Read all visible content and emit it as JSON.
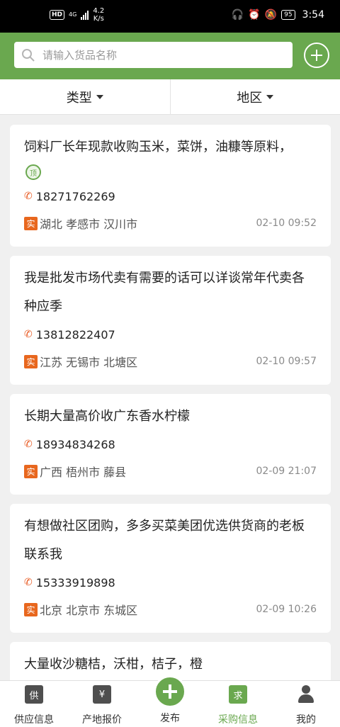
{
  "status_bar": {
    "hd": "HD",
    "network": "4G",
    "speed_value": "4.2",
    "speed_unit": "K/s",
    "battery": "95",
    "time": "3:54"
  },
  "search": {
    "placeholder": "请输入货品名称"
  },
  "filters": [
    {
      "label": "类型"
    },
    {
      "label": "地区"
    }
  ],
  "listings": [
    {
      "title": "饲料厂长年现款收购玉米，菜饼，油糠等原料，",
      "badge": "顶",
      "phone": "18271762269",
      "tag": "实",
      "location": "湖北 孝感市 汉川市",
      "time": "02-10 09:52"
    },
    {
      "title": "我是批发市场代卖有需要的话可以详谈常年代卖各种应季",
      "phone": "13812822407",
      "tag": "实",
      "location": "江苏 无锡市 北塘区",
      "time": "02-10 09:57"
    },
    {
      "title": "长期大量高价收广东香水柠檬",
      "phone": "18934834268",
      "tag": "实",
      "location": "广西 梧州市 藤县",
      "time": "02-09 21:07"
    },
    {
      "title": "有想做社区团购，多多买菜美团优选供货商的老板联系我",
      "phone": "15333919898",
      "tag": "实",
      "location": "北京 北京市 东城区",
      "time": "02-09 10:26"
    },
    {
      "title": "大量收沙糖桔，沃柑，桔子，橙"
    }
  ],
  "tabs": [
    {
      "label": "供应信息",
      "icon": "供"
    },
    {
      "label": "产地报价",
      "icon": "¥"
    },
    {
      "label": "发布"
    },
    {
      "label": "采购信息",
      "icon": "求",
      "active": true
    },
    {
      "label": "我的"
    }
  ],
  "colors": {
    "brand_green": "#6aa84f",
    "tag_orange": "#e8671e",
    "phone_icon": "#e8571e"
  }
}
